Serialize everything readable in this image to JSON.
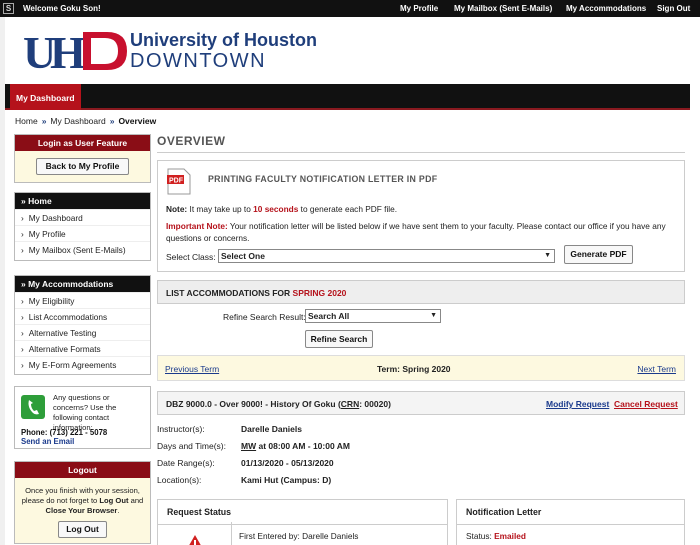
{
  "topbar": {
    "welcome": "Welcome Goku Son!",
    "links": [
      "My Profile",
      "My Mailbox (Sent E-Mails)",
      "My Accommodations",
      "Sign Out"
    ]
  },
  "brand": {
    "logo_letters": "UHD",
    "line1": "University of Houston",
    "line2": "DOWNTOWN"
  },
  "nav": {
    "tab": "My Dashboard"
  },
  "breadcrumb": {
    "home": "Home",
    "dashboard": "My Dashboard",
    "current": "Overview",
    "sep": "»"
  },
  "sidebar": {
    "login_feature": {
      "title": "Login as User Feature",
      "button": "Back to My Profile"
    },
    "home": {
      "title": "Home",
      "items": [
        "My Dashboard",
        "My Profile",
        "My Mailbox (Sent E-Mails)"
      ]
    },
    "accommodations": {
      "title": "My Accommodations",
      "items": [
        "My Eligibility",
        "List Accommodations",
        "Alternative Testing",
        "Alternative Formats",
        "My E-Form Agreements"
      ]
    },
    "contact": {
      "text": "Any questions or concerns? Use the following contact information:",
      "phone": "Phone: (713) 221 - 5078",
      "email": "Send an Email"
    },
    "logout": {
      "title": "Logout",
      "text_1": "Once you finish with your session, please do not forget to ",
      "log_out": "Log Out",
      "text_2": " and ",
      "close_browser": "Close Your Browser",
      "text_3": ".",
      "button": "Log Out"
    }
  },
  "main": {
    "title": "OVERVIEW",
    "pdf": {
      "icon_label": "PDF",
      "heading": "PRINTING FACULTY NOTIFICATION LETTER IN PDF",
      "note_label": "Note:",
      "note_1": " It may take up to ",
      "note_seconds": "10 seconds",
      "note_2": " to generate each PDF file.",
      "important_label": "Important Note:",
      "important_text": " Your notification letter will be listed below if we have sent them to your faculty. Please contact our office if you have any questions or concerns.",
      "select_label": "Select Class:",
      "select_value": "Select One",
      "generate_button": "Generate PDF"
    },
    "list": {
      "heading_prefix": "LIST ACCOMMODATIONS FOR ",
      "heading_term": "SPRING 2020",
      "refine_label": "Refine Search Result:",
      "refine_value": "Search All",
      "refine_button": "Refine Search"
    },
    "term": {
      "previous": "Previous Term",
      "current": "Term: Spring 2020",
      "next": "Next Term"
    },
    "course": {
      "title": "DBZ 9000.0 - Over 9000! - History Of Goku",
      "crn_label": "CRN",
      "crn": "00020",
      "modify": "Modify Request",
      "cancel": "Cancel Request",
      "instructor_label": "Instructor(s):",
      "instructor": "Darelle Daniels",
      "days_label": "Days and Time(s):",
      "days": "MW",
      "time": " at 08:00 AM - 10:00 AM",
      "dates_label": "Date Range(s):",
      "dates": "01/13/2020 - 05/13/2020",
      "location_label": "Location(s):",
      "location": "Kami Hut (Campus: D)"
    },
    "request_status": {
      "title": "Request Status",
      "first_entered": "First Entered by: Darelle Daniels"
    },
    "notification": {
      "title": "Notification Letter",
      "status_label": "Status:",
      "status_value": "Emailed"
    }
  },
  "colors": {
    "brand_blue": "#1f3e7b",
    "brand_red": "#b5121b",
    "nav_black": "#111111"
  }
}
